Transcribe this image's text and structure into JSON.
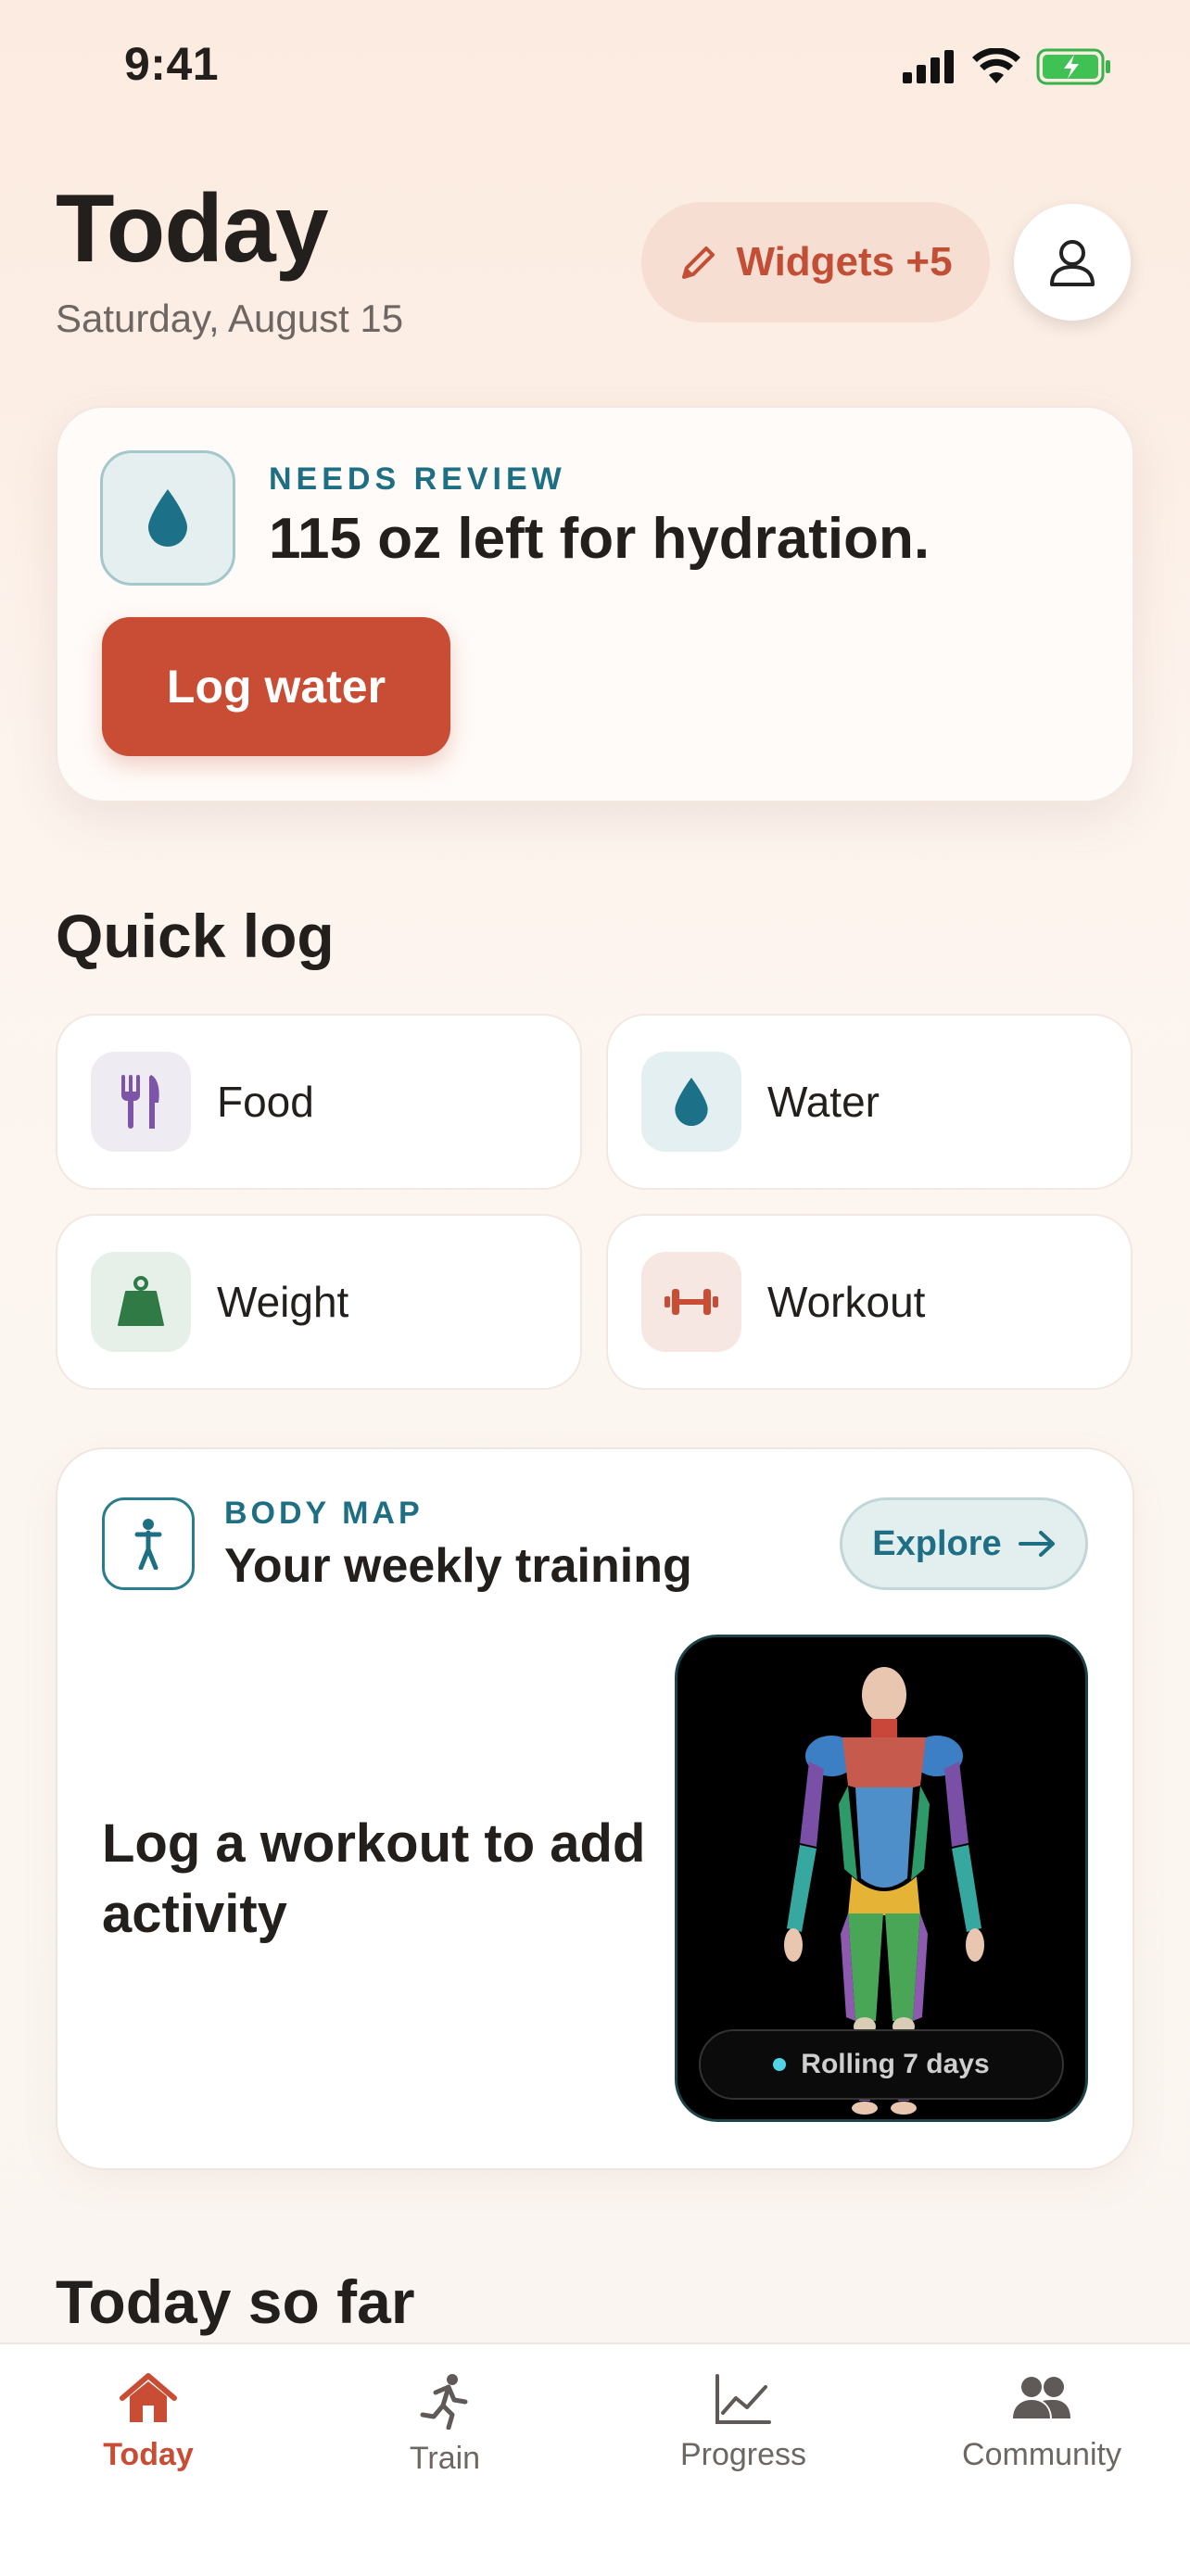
{
  "status_bar": {
    "time": "9:41"
  },
  "header": {
    "title": "Today",
    "date": "Saturday, August 15",
    "widgets_label": "Widgets +5"
  },
  "review_card": {
    "eyebrow": "NEEDS REVIEW",
    "title": "115 oz left for hydration.",
    "button": "Log water"
  },
  "quick_log": {
    "title": "Quick log",
    "items": [
      {
        "label": "Food",
        "icon": "fork-knife-icon"
      },
      {
        "label": "Water",
        "icon": "water-drop-icon"
      },
      {
        "label": "Weight",
        "icon": "weight-icon"
      },
      {
        "label": "Workout",
        "icon": "dumbbell-icon"
      }
    ]
  },
  "body_map": {
    "eyebrow": "BODY MAP",
    "title": "Your weekly training",
    "explore": "Explore",
    "empty_message": "Log a workout to add activity",
    "rolling": "Rolling 7 days"
  },
  "today_so_far": {
    "title": "Today so far"
  },
  "tabbar": {
    "tabs": [
      {
        "label": "Today",
        "active": true
      },
      {
        "label": "Train",
        "active": false
      },
      {
        "label": "Progress",
        "active": false
      },
      {
        "label": "Community",
        "active": false
      }
    ]
  },
  "colors": {
    "accent": "#c84d34",
    "teal": "#1e6f84",
    "food_tile_bg": "#eeebf3",
    "water_tile_bg": "#e3eff0",
    "weight_tile_bg": "#e6efe8",
    "workout_tile_bg": "#f7e7e3"
  }
}
